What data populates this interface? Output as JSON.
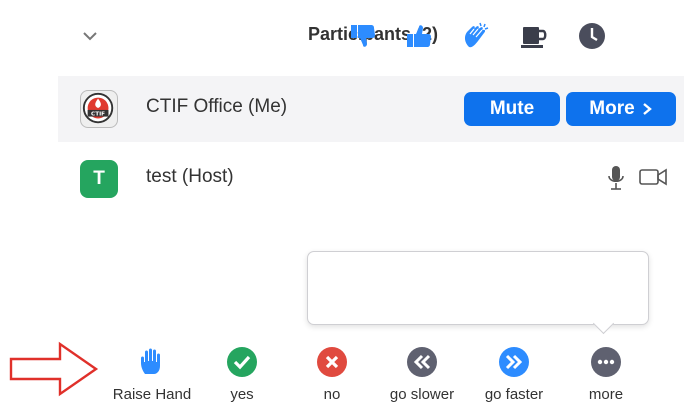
{
  "header": {
    "title": "Participants (2)"
  },
  "participants": [
    {
      "name": "CTIF Office (Me)",
      "avatar_text": "CTIF",
      "buttons": {
        "mute": "Mute",
        "more": "More"
      }
    },
    {
      "name": "test (Host)",
      "avatar_letter": "T"
    }
  ],
  "reactions": [
    {
      "icon": "thumbs-down-icon"
    },
    {
      "icon": "thumbs-up-icon"
    },
    {
      "icon": "clap-icon"
    },
    {
      "icon": "coffee-icon"
    },
    {
      "icon": "clock-icon"
    }
  ],
  "feedback": [
    {
      "label": "Raise Hand",
      "icon": "raise-hand-icon",
      "color": "#2d8cff"
    },
    {
      "label": "yes",
      "icon": "check-icon",
      "color": "#25a55f"
    },
    {
      "label": "no",
      "icon": "x-icon",
      "color": "#e04a3f"
    },
    {
      "label": "go slower",
      "icon": "rewind-icon",
      "color": "#5f6170"
    },
    {
      "label": "go faster",
      "icon": "fast-forward-icon",
      "color": "#2d8cff"
    },
    {
      "label": "more",
      "icon": "ellipsis-icon",
      "color": "#5f6170"
    }
  ],
  "colors": {
    "accent": "#0e72ed",
    "icon_blue": "#2d8cff",
    "annotation_red": "#e0302a"
  }
}
